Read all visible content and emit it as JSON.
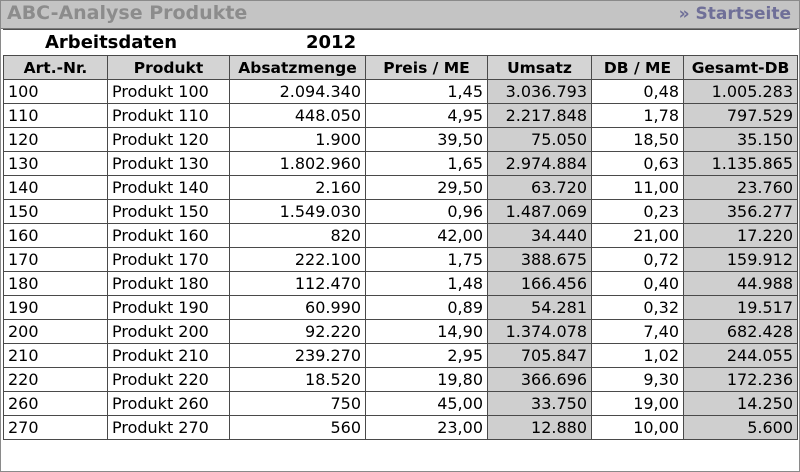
{
  "header": {
    "title": "ABC-Analyse Produkte",
    "home_link": "» Startseite"
  },
  "workdata": {
    "label": "Arbeitsdaten",
    "year": "2012"
  },
  "table": {
    "columns": [
      "Art.-Nr.",
      "Produkt",
      "Absatzmenge",
      "Preis / ME",
      "Umsatz",
      "DB / ME",
      "Gesamt-DB"
    ],
    "rows": [
      [
        "100",
        "Produkt 100",
        "2.094.340",
        "1,45",
        "3.036.793",
        "0,48",
        "1.005.283"
      ],
      [
        "110",
        "Produkt 110",
        "448.050",
        "4,95",
        "2.217.848",
        "1,78",
        "797.529"
      ],
      [
        "120",
        "Produkt 120",
        "1.900",
        "39,50",
        "75.050",
        "18,50",
        "35.150"
      ],
      [
        "130",
        "Produkt 130",
        "1.802.960",
        "1,65",
        "2.974.884",
        "0,63",
        "1.135.865"
      ],
      [
        "140",
        "Produkt 140",
        "2.160",
        "29,50",
        "63.720",
        "11,00",
        "23.760"
      ],
      [
        "150",
        "Produkt 150",
        "1.549.030",
        "0,96",
        "1.487.069",
        "0,23",
        "356.277"
      ],
      [
        "160",
        "Produkt 160",
        "820",
        "42,00",
        "34.440",
        "21,00",
        "17.220"
      ],
      [
        "170",
        "Produkt 170",
        "222.100",
        "1,75",
        "388.675",
        "0,72",
        "159.912"
      ],
      [
        "180",
        "Produkt 180",
        "112.470",
        "1,48",
        "166.456",
        "0,40",
        "44.988"
      ],
      [
        "190",
        "Produkt 190",
        "60.990",
        "0,89",
        "54.281",
        "0,32",
        "19.517"
      ],
      [
        "200",
        "Produkt 200",
        "92.220",
        "14,90",
        "1.374.078",
        "7,40",
        "682.428"
      ],
      [
        "210",
        "Produkt 210",
        "239.270",
        "2,95",
        "705.847",
        "1,02",
        "244.055"
      ],
      [
        "220",
        "Produkt 220",
        "18.520",
        "19,80",
        "366.696",
        "9,30",
        "172.236"
      ],
      [
        "260",
        "Produkt 260",
        "750",
        "45,00",
        "33.750",
        "19,00",
        "14.250"
      ],
      [
        "270",
        "Produkt 270",
        "560",
        "23,00",
        "12.880",
        "10,00",
        "5.600"
      ]
    ]
  },
  "colors": {
    "titlebar_bg": "#c4c4c4",
    "title_text": "#8c8c8c",
    "link_text": "#6f6f98",
    "header_bg": "#d4d4d4",
    "computed_cell_bg": "#cfcfcf"
  }
}
